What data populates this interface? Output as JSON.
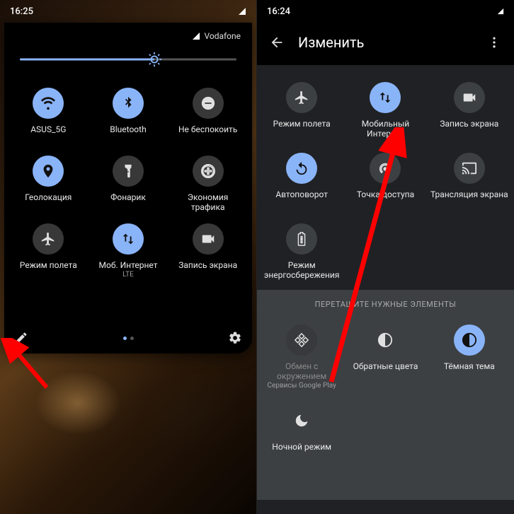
{
  "left": {
    "time": "16:25",
    "carrier": "Vodafone",
    "brightness_percent": 62,
    "tiles": [
      {
        "icon": "wifi",
        "label": "ASUS_5G",
        "active": true
      },
      {
        "icon": "bluetooth",
        "label": "Bluetooth",
        "active": true
      },
      {
        "icon": "dnd",
        "label": "Не беспокоить",
        "active": false
      },
      {
        "icon": "location",
        "label": "Геолокация",
        "active": true
      },
      {
        "icon": "flashlight",
        "label": "Фонарик",
        "active": false
      },
      {
        "icon": "datasaver",
        "label": "Экономия трафика",
        "active": false
      },
      {
        "icon": "airplane",
        "label": "Режим полета",
        "active": false
      },
      {
        "icon": "mobiledata",
        "label": "Моб. Интернет",
        "sublabel": "LTE",
        "active": true
      },
      {
        "icon": "record",
        "label": "Запись экрана",
        "active": false
      }
    ],
    "page_count": 2,
    "page_active": 0
  },
  "right": {
    "time": "16:24",
    "header_title": "Изменить",
    "active_section": [
      {
        "icon": "airplane",
        "label": "Режим полета",
        "active": false
      },
      {
        "icon": "mobiledata",
        "label": "Мобильный Интернет",
        "active": true
      },
      {
        "icon": "record",
        "label": "Запись экрана",
        "active": false
      },
      {
        "icon": "rotate",
        "label": "Автоповорот",
        "active": true
      },
      {
        "icon": "hotspot",
        "label": "Точка доступа",
        "active": false
      },
      {
        "icon": "cast",
        "label": "Трансляция экрана",
        "active": false
      },
      {
        "icon": "battery",
        "label": "Режим энергосбережения",
        "active": false
      }
    ],
    "drag_hint": "ПЕРЕТАЩИТЕ НУЖНЫЕ ЭЛЕМЕНТЫ",
    "inactive_section": [
      {
        "icon": "nearby",
        "label": "Обмен с окружением",
        "sublabel": "Сервисы Google Play",
        "dim": true
      },
      {
        "icon": "invert",
        "label": "Обратные цвета",
        "active": false
      },
      {
        "icon": "darktheme",
        "label": "Тёмная тема",
        "active": true,
        "accent": true
      },
      {
        "icon": "moon",
        "label": "Ночной режим",
        "active": false
      }
    ]
  },
  "colors": {
    "accent": "#8ab4f8",
    "panel": "#202124",
    "arrow": "#ff0000"
  }
}
